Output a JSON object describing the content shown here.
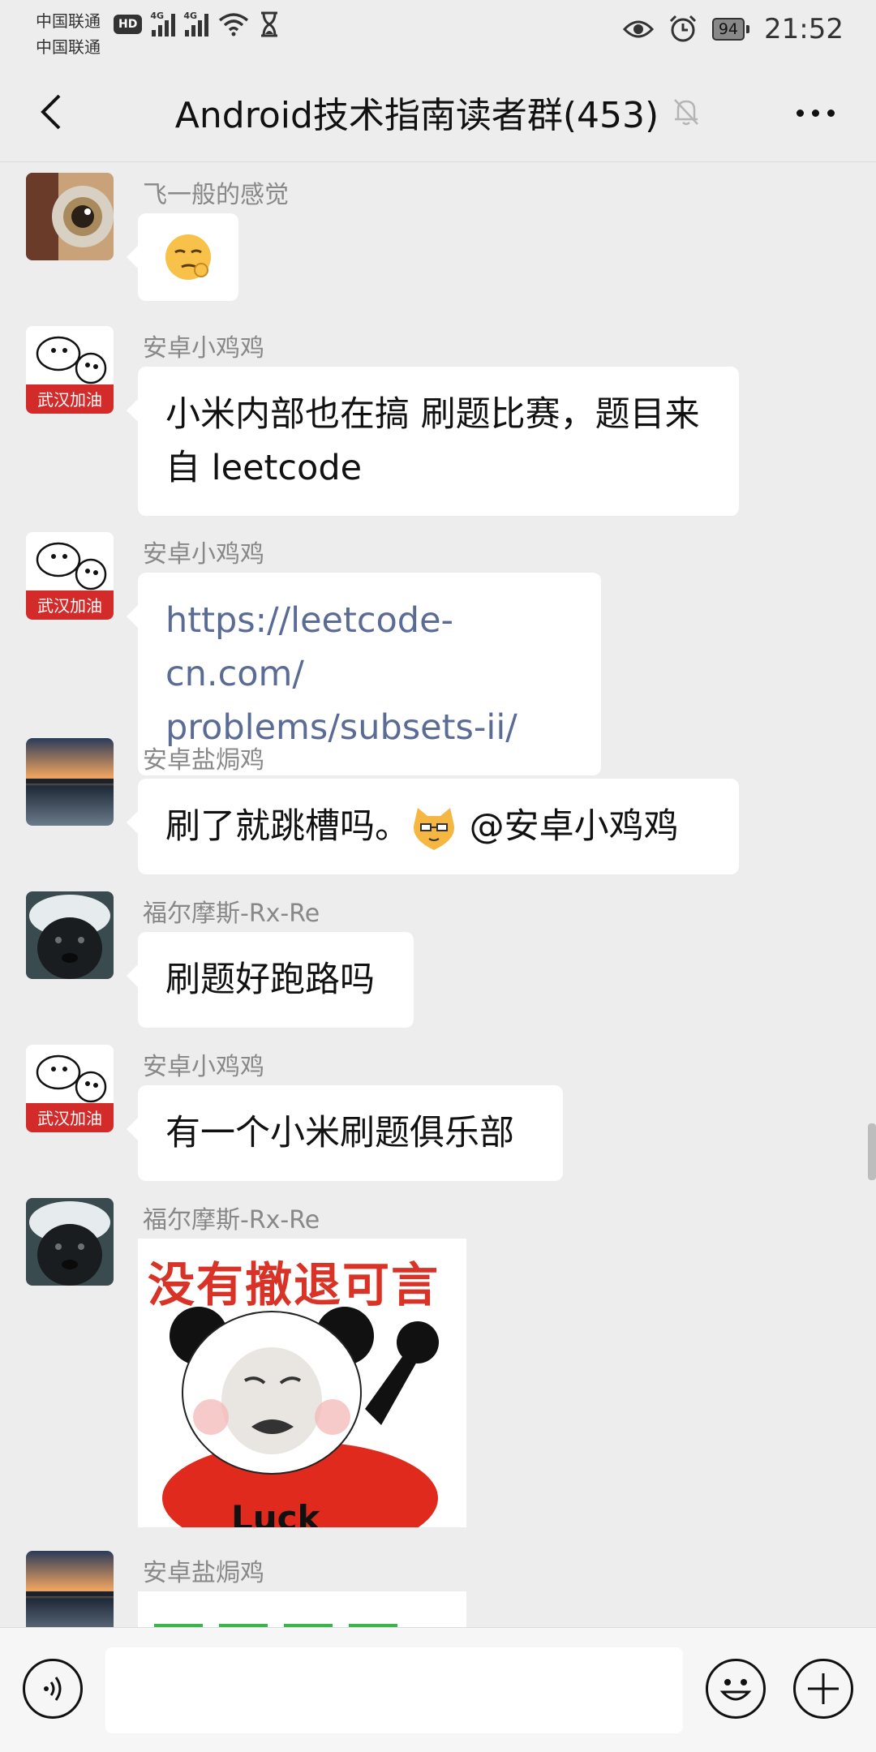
{
  "status_bar": {
    "carrier_1": "中国联通",
    "carrier_2": "中国联通",
    "hd_badge": "HD",
    "network_1": "4G",
    "network_2": "4G",
    "battery": "94",
    "time": "21:52"
  },
  "header": {
    "title": "Android技术指南读者群(453)"
  },
  "messages": [
    {
      "sender": "飞一般的感觉",
      "type": "emoji"
    },
    {
      "sender": "安卓小鸡鸡",
      "type": "text",
      "line1": "小米内部也在搞 刷题比赛，题目来",
      "line2": "自 leetcode"
    },
    {
      "sender": "安卓小鸡鸡",
      "type": "link",
      "line1": "https://leetcode-cn.com/",
      "line2": "problems/subsets-ii/"
    },
    {
      "sender": "安卓盐焗鸡",
      "type": "text",
      "before": "刷了就跳槽吗。",
      "after": " @安卓小鸡鸡"
    },
    {
      "sender": "福尔摩斯-Rx-Re",
      "type": "text",
      "text": "刷题好跑路吗"
    },
    {
      "sender": "安卓小鸡鸡",
      "type": "text",
      "text": "有一个小米刷题俱乐部"
    },
    {
      "sender": "福尔摩斯-Rx-Re",
      "type": "sticker",
      "sticker_text": "没有撤退可言",
      "sticker_caption": "Luck"
    },
    {
      "sender": "安卓盐焗鸡",
      "type": "sticker"
    }
  ],
  "avatar_labels": {
    "peppa": "武汉加油"
  },
  "input": {
    "placeholder": ""
  }
}
